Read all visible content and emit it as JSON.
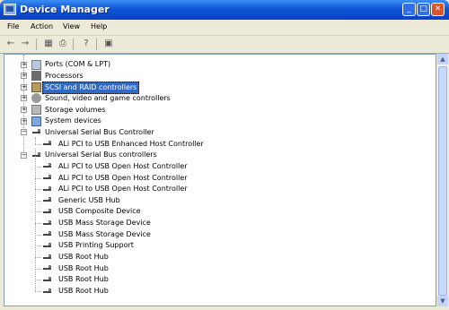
{
  "window": {
    "title": "Device Manager",
    "controls": {
      "minimize": "_",
      "maximize": "□",
      "close": "✕"
    }
  },
  "menu": [
    "File",
    "Action",
    "View",
    "Help"
  ],
  "toolbar": [
    "back-icon",
    "forward-icon",
    "properties-icon",
    "print-icon",
    "help-icon",
    "scan-hardware-icon"
  ],
  "tree": [
    {
      "label": "Ports (COM & LPT)",
      "icon": "ports-icon",
      "expander": "+",
      "level": 0
    },
    {
      "label": "Processors",
      "icon": "processor-icon",
      "expander": "+",
      "level": 0
    },
    {
      "label": "SCSI and RAID controllers",
      "icon": "scsi-icon",
      "expander": "+",
      "level": 0,
      "selected": true
    },
    {
      "label": "Sound, video and game controllers",
      "icon": "sound-icon",
      "expander": "+",
      "level": 0
    },
    {
      "label": "Storage volumes",
      "icon": "storage-icon",
      "expander": "+",
      "level": 0
    },
    {
      "label": "System devices",
      "icon": "system-icon",
      "expander": "+",
      "level": 0
    },
    {
      "label": "Universal Serial Bus Controller",
      "icon": "usb-icon",
      "expander": "−",
      "level": 0
    },
    {
      "label": "ALi PCI to USB Enhanced Host Controller",
      "icon": "usb-icon",
      "level": 1
    },
    {
      "label": "Universal Serial Bus controllers",
      "icon": "usb-icon",
      "expander": "−",
      "level": 0
    },
    {
      "label": "ALi PCI to USB Open Host Controller",
      "icon": "usb-icon",
      "level": 1
    },
    {
      "label": "ALi PCI to USB Open Host Controller",
      "icon": "usb-icon",
      "level": 1
    },
    {
      "label": "ALi PCI to USB Open Host Controller",
      "icon": "usb-icon",
      "level": 1
    },
    {
      "label": "Generic USB Hub",
      "icon": "usb-icon",
      "level": 1
    },
    {
      "label": "USB Composite Device",
      "icon": "usb-icon",
      "level": 1
    },
    {
      "label": "USB Mass Storage Device",
      "icon": "usb-icon",
      "level": 1
    },
    {
      "label": "USB Mass Storage Device",
      "icon": "usb-icon",
      "level": 1
    },
    {
      "label": "USB Printing Support",
      "icon": "usb-icon",
      "level": 1
    },
    {
      "label": "USB Root Hub",
      "icon": "usb-icon",
      "level": 1
    },
    {
      "label": "USB Root Hub",
      "icon": "usb-icon",
      "level": 1
    },
    {
      "label": "USB Root Hub",
      "icon": "usb-icon",
      "level": 1
    },
    {
      "label": "USB Root Hub",
      "icon": "usb-icon",
      "level": 1
    }
  ],
  "colors": {
    "titlebar": "#0f56d6",
    "selection": "#316ac5"
  }
}
